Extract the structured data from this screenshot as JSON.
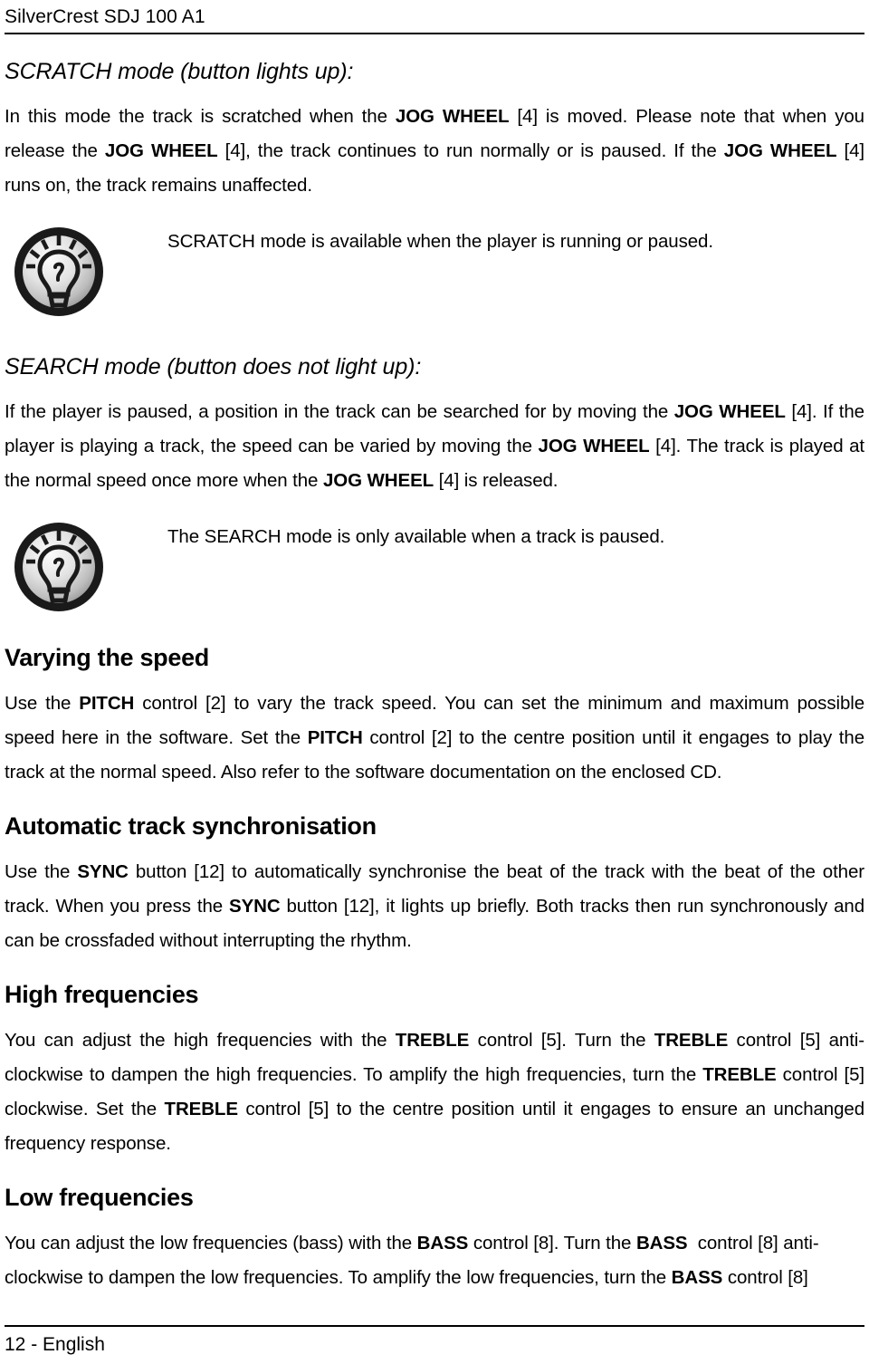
{
  "header": {
    "product_title": "SilverCrest SDJ 100 A1"
  },
  "sections": [
    {
      "id": "scratch-mode",
      "heading": "SCRATCH mode (button lights up):",
      "heading_style": "italic",
      "paragraph_html": "In this mode the track is scratched when the <b>JOG WHEEL</b> [4] is moved. Please note that when you release the <b>JOG WHEEL</b> [4], the track continues to run normally or is paused. If the <b>JOG WHEEL</b> [4] runs on, the track remains unaffected.",
      "note": {
        "icon": "lightbulb-tip-icon",
        "text": "SCRATCH mode is available when the player is running or paused."
      }
    },
    {
      "id": "search-mode",
      "heading": "SEARCH mode (button does not light up):",
      "heading_style": "italic",
      "paragraph_html": "If the player is paused, a position in the track can be searched for by moving the <b>JOG WHEEL</b> [4]. If the player is playing a track, the speed can be varied by moving the <b>JOG WHEEL</b> [4]. The track is played at the normal speed once more when the <b>JOG WHEEL</b> [4] is released.",
      "note": {
        "icon": "lightbulb-tip-icon",
        "text": "The SEARCH mode is only available when a track is paused."
      }
    },
    {
      "id": "varying-the-speed",
      "heading": "Varying the speed",
      "heading_style": "bold",
      "paragraph_html": "Use the <b>PITCH</b> control [2] to vary the track speed. You can set the minimum and maximum possible speed here in the software. Set the <b>PITCH</b> control [2] to the centre position until it engages to play the track at the normal speed. Also refer to the software documentation on the enclosed CD."
    },
    {
      "id": "automatic-track-synchronisation",
      "heading": "Automatic track synchronisation",
      "heading_style": "bold",
      "paragraph_html": "Use the <b>SYNC</b> button [12] to automatically synchronise the beat of the track with the beat of the other track. When you press the <b>SYNC</b> button [12], it lights up briefly. Both tracks then run synchronously and can be crossfaded without interrupting the rhythm."
    },
    {
      "id": "high-frequencies",
      "heading": "High frequencies",
      "heading_style": "bold",
      "paragraph_html": "You can adjust the high frequencies with the <b>TREBLE</b> control [5]. Turn the <b>TREBLE</b> control [5] anti-clockwise to dampen the high frequencies. To amplify the high frequencies, turn the <b>TREBLE</b> control [5] clockwise. Set the <b>TREBLE</b> control [5] to the centre position until it engages to ensure an unchanged frequency response."
    },
    {
      "id": "low-frequencies",
      "heading": "Low frequencies",
      "heading_style": "bold",
      "paragraph_html": "You can adjust the low frequencies (bass) with the <b>BASS</b> control [8]. Turn the <b>BASS</b> &nbsp;control [8] anti-clockwise to dampen the low frequencies. To amplify the low frequencies, turn the <b>BASS</b> control [8]"
    }
  ],
  "footer": {
    "page_label": "12 - English"
  },
  "colors": {
    "text": "#000000",
    "page_background": "#ffffff",
    "rule": "#000000",
    "icon_ring": "#1a1a1a",
    "icon_fill_light": "#f2f2f2",
    "icon_fill_dark": "#9a9a9a"
  }
}
